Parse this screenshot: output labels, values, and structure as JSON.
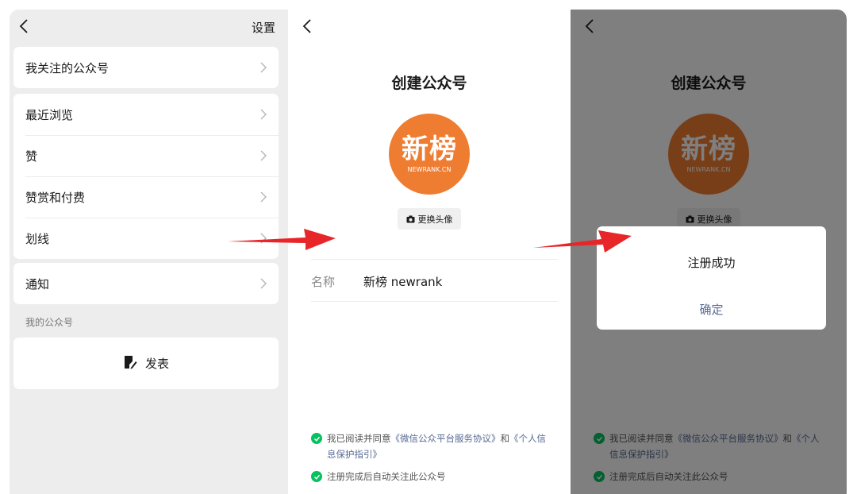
{
  "panel1": {
    "settings_label": "设置",
    "card1": [
      {
        "label": "我关注的公众号"
      }
    ],
    "card2": [
      {
        "label": "最近浏览"
      },
      {
        "label": "赞"
      },
      {
        "label": "赞赏和付费"
      },
      {
        "label": "划线"
      }
    ],
    "card3": [
      {
        "label": "通知"
      }
    ],
    "section_label": "我的公众号",
    "publish_label": "发表"
  },
  "create": {
    "title": "创建公众号",
    "avatar_text_big": "新榜",
    "avatar_text_small": "NEWRANK.CN",
    "avatar_color": "#ef7d31",
    "change_avatar_label": "更换头像",
    "name_label": "名称",
    "name_value": "新榜 newrank",
    "agree_prefix": "我已阅读并同意",
    "agree_link1": "《微信公众平台服务协议》",
    "agree_and": "和",
    "agree_link2": "《个人信息保护指引》",
    "auto_follow": "注册完成后自动关注此公众号"
  },
  "dialog": {
    "message": "注册成功",
    "confirm_label": "确定"
  },
  "colors": {
    "accent_green": "#07c160",
    "link_blue": "#576b95",
    "arrow_red": "#e8262a"
  }
}
